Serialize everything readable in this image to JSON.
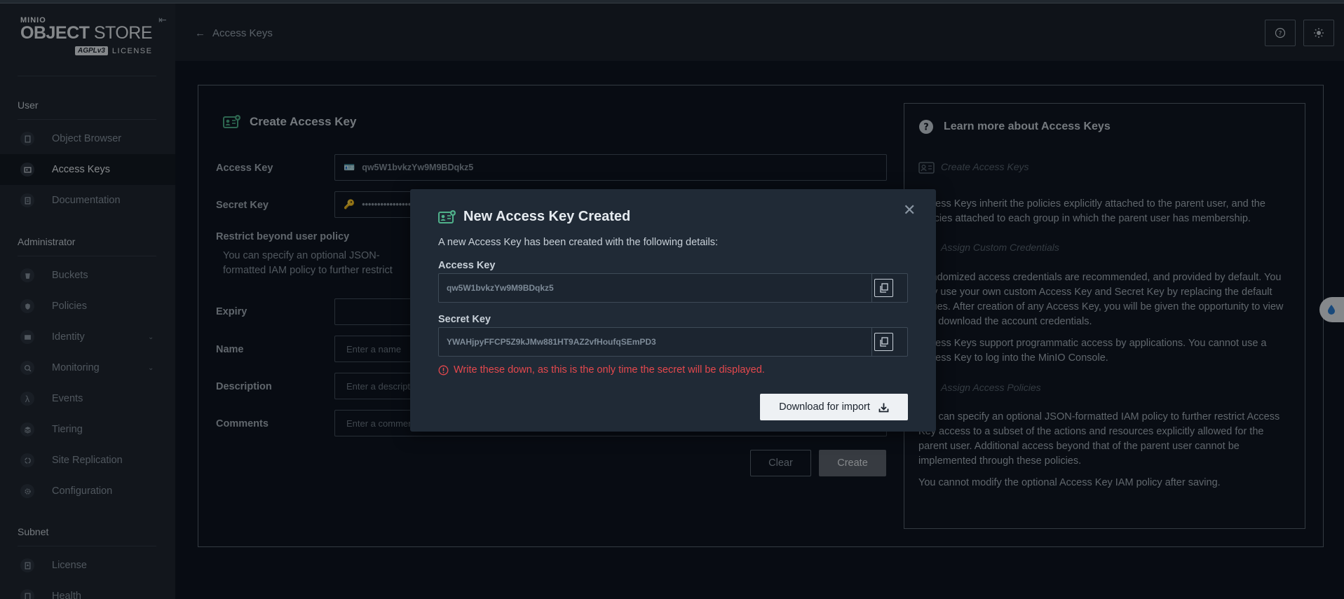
{
  "app": {
    "brand": "MINIO",
    "product_bold": "OBJECT",
    "product_thin": "STORE",
    "license_badge": "AGPLv3",
    "license_label": "LICENSE"
  },
  "sidebar": {
    "sections": {
      "user": "User",
      "administrator": "Administrator",
      "subnet": "Subnet"
    },
    "items": [
      {
        "label": "Object Browser",
        "icon": "object-browser-icon"
      },
      {
        "label": "Access Keys",
        "icon": "access-keys-icon",
        "active": true
      },
      {
        "label": "Documentation",
        "icon": "documentation-icon"
      },
      {
        "label": "Buckets",
        "icon": "bucket-icon"
      },
      {
        "label": "Policies",
        "icon": "policy-icon"
      },
      {
        "label": "Identity",
        "icon": "identity-icon",
        "expandable": true
      },
      {
        "label": "Monitoring",
        "icon": "monitoring-icon",
        "expandable": true
      },
      {
        "label": "Events",
        "icon": "lambda-icon"
      },
      {
        "label": "Tiering",
        "icon": "tiering-icon"
      },
      {
        "label": "Site Replication",
        "icon": "replication-icon"
      },
      {
        "label": "Configuration",
        "icon": "gear-icon"
      },
      {
        "label": "License",
        "icon": "license-icon"
      },
      {
        "label": "Health",
        "icon": "health-icon"
      }
    ]
  },
  "header": {
    "back_label": "Access Keys"
  },
  "form": {
    "title": "Create Access Key",
    "access_key_label": "Access Key",
    "access_key_value": "qw5W1bvkzYw9M9BDqkz5",
    "secret_key_label": "Secret Key",
    "secret_key_value": "••••••••••••••••",
    "restrict_title": "Restrict beyond user policy",
    "restrict_text": "You can specify an optional JSON-formatted IAM policy to further restrict Access Key access to a subset of the actions and resources explicitly allowed for the parent user. Additional access beyond that of the parent user cannot be implemented through these policies.",
    "expiry_label": "Expiry",
    "name_label": "Name",
    "name_placeholder": "Enter a name",
    "description_label": "Description",
    "description_placeholder": "Enter a description",
    "comments_label": "Comments",
    "comments_placeholder": "Enter a comment",
    "clear_label": "Clear",
    "create_label": "Create"
  },
  "help": {
    "title": "Learn more about Access Keys",
    "sub1": "Create Access Keys",
    "text1": "Access Keys inherit the policies explicitly attached to the parent user, and the policies attached to each group in which the parent user has membership.",
    "sub2": "Assign Custom Credentials",
    "text2": "Randomized access credentials are recommended, and provided by default. You may use your own custom Access Key and Secret Key by replacing the default values. After creation of any Access Key, you will be given the opportunity to view and download the account credentials.",
    "text3": "Access Keys support programmatic access by applications. You cannot use a Access Key to log into the MinIO Console.",
    "sub3": "Assign Access Policies",
    "text4": "You can specify an optional JSON-formatted IAM policy to further restrict Access Key access to a subset of the actions and resources explicitly allowed for the parent user. Additional access beyond that of the parent user cannot be implemented through these policies.",
    "text5": "You cannot modify the optional Access Key IAM policy after saving."
  },
  "modal": {
    "title": "New Access Key Created",
    "description": "A new Access Key has been created with the following details:",
    "access_key_label": "Access Key",
    "access_key_value": "qw5W1bvkzYw9M9BDqkz5",
    "secret_key_label": "Secret Key",
    "secret_key_value": "YWAHjpyFFCP5Z9kJMw881HT9AZ2vfHoufqSEmPD3",
    "warning": "Write these down, as this is the only time the secret will be displayed.",
    "download_label": "Download for import"
  },
  "colors": {
    "accent_green": "#4fb08a",
    "danger": "#e5484d",
    "sidebar_bg": "#1f2731",
    "main_bg": "#0e1621"
  }
}
